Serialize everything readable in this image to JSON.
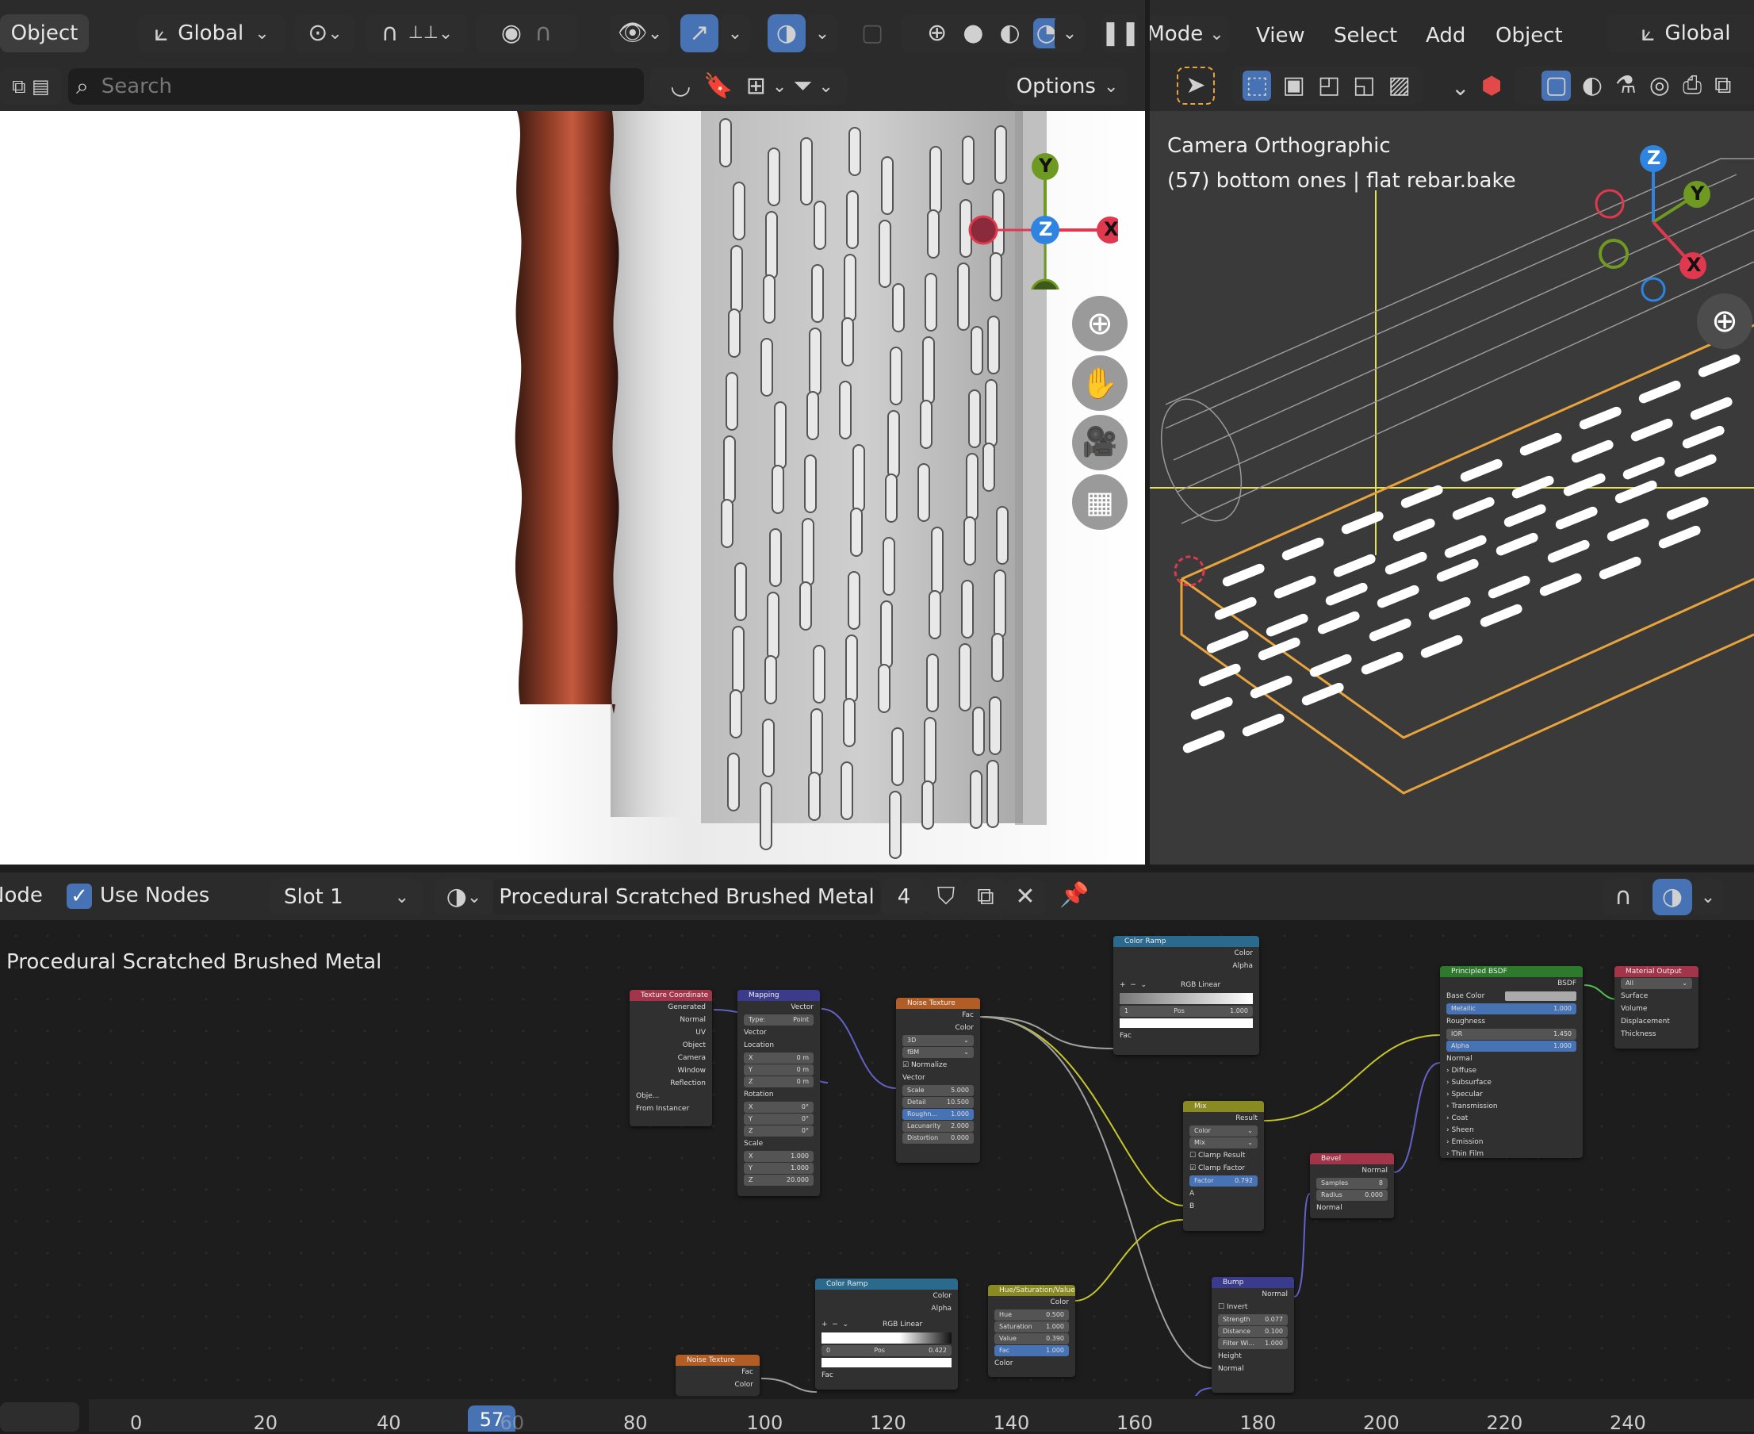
{
  "header_left": {
    "mode": "Object",
    "orientation": "Global",
    "search_placeholder": "Search",
    "options": "Options"
  },
  "header_right": {
    "mode": "Mode",
    "menu": [
      "View",
      "Select",
      "Add",
      "Object"
    ],
    "orientation": "Global"
  },
  "viewport2": {
    "line1": "Camera Orthographic",
    "line2": "(57) bottom ones | flat rebar.bake"
  },
  "gizmo": {
    "x": "X",
    "y": "Y",
    "z": "Z"
  },
  "node_header": {
    "mode": "Node",
    "use_nodes": "Use Nodes",
    "slot": "Slot 1",
    "material": "Procedural Scratched Brushed Metal",
    "users": "4"
  },
  "editor_title": "Procedural Scratched Brushed Metal",
  "nodes": {
    "texcoord": {
      "title": "Texture Coordinate",
      "outputs": [
        "Generated",
        "Normal",
        "UV",
        "Object",
        "Camera",
        "Window",
        "Reflection"
      ],
      "obj": "Obje...",
      "from_instancer": "From Instancer"
    },
    "mapping": {
      "title": "Mapping",
      "out": "Vector",
      "type_label": "Type:",
      "type": "Point",
      "vector": "Vector",
      "location": "Location",
      "loc": [
        "0 m",
        "0 m",
        "0 m"
      ],
      "rotation": "Rotation",
      "rot": [
        "0°",
        "0°",
        "0°"
      ],
      "scale": "Scale",
      "scl": [
        "1.000",
        "1.000",
        "20.000"
      ]
    },
    "noise1": {
      "title": "Noise Texture",
      "fac": "Fac",
      "color": "Color",
      "dim": "3D",
      "type": "fBM",
      "normalize": "Normalize",
      "vector": "Vector",
      "fields": [
        [
          "Scale",
          "5.000"
        ],
        [
          "Detail",
          "10.500"
        ],
        [
          "Roughn...",
          "1.000"
        ],
        [
          "Lacunarity",
          "2.000"
        ],
        [
          "Distortion",
          "0.000"
        ]
      ]
    },
    "ramp1": {
      "title": "Color Ramp",
      "color": "Color",
      "alpha": "Alpha",
      "mode": "RGB",
      "interp": "Linear",
      "index": "1",
      "pos_label": "Pos",
      "pos": "1.000",
      "fac": "Fac"
    },
    "mix": {
      "title": "Mix",
      "result": "Result",
      "type": "Color",
      "blend": "Mix",
      "clamp_result": "Clamp Result",
      "clamp_factor": "Clamp Factor",
      "factor_label": "Factor",
      "factor": "0.792",
      "a": "A",
      "b": "B"
    },
    "bevel": {
      "title": "Bevel",
      "normal_out": "Normal",
      "samples_label": "Samples",
      "samples": "8",
      "radius_label": "Radius",
      "radius": "0.000",
      "normal": "Normal"
    },
    "bsdf": {
      "title": "Principled BSDF",
      "out": "BSDF",
      "base_color": "Base Color",
      "metallic": "Metallic",
      "metallic_val": "1.000",
      "roughness": "Roughness",
      "ior": "IOR",
      "ior_val": "1.450",
      "alpha": "Alpha",
      "alpha_val": "1.000",
      "normal": "Normal",
      "panels": [
        "Diffuse",
        "Subsurface",
        "Specular",
        "Transmission",
        "Coat",
        "Sheen",
        "Emission",
        "Thin Film"
      ]
    },
    "output": {
      "title": "Material Output",
      "target": "All",
      "inputs": [
        "Surface",
        "Volume",
        "Displacement",
        "Thickness"
      ]
    },
    "ramp2": {
      "title": "Color Ramp",
      "color": "Color",
      "alpha": "Alpha",
      "mode": "RGB",
      "interp": "Linear",
      "index": "0",
      "pos_label": "Pos",
      "pos": "0.422",
      "fac": "Fac"
    },
    "hsv": {
      "title": "Hue/Saturation/Value",
      "color": "Color",
      "fields": [
        [
          "Hue",
          "0.500"
        ],
        [
          "Saturation",
          "1.000"
        ],
        [
          "Value",
          "0.390"
        ],
        [
          "Fac",
          "1.000"
        ]
      ],
      "color_in": "Color"
    },
    "bump": {
      "title": "Bump",
      "normal_out": "Normal",
      "invert": "Invert",
      "fields": [
        [
          "Strength",
          "0.077"
        ],
        [
          "Distance",
          "0.100"
        ],
        [
          "Filter Wi...",
          "1.000"
        ]
      ],
      "height": "Height",
      "normal": "Normal"
    },
    "noise2": {
      "title": "Noise Texture",
      "fac": "Fac",
      "color": "Color"
    }
  },
  "timeline": {
    "current": "57",
    "ticks": [
      "0",
      "20",
      "40",
      "60",
      "80",
      "100",
      "120",
      "140",
      "160",
      "180",
      "200",
      "220",
      "240"
    ]
  }
}
